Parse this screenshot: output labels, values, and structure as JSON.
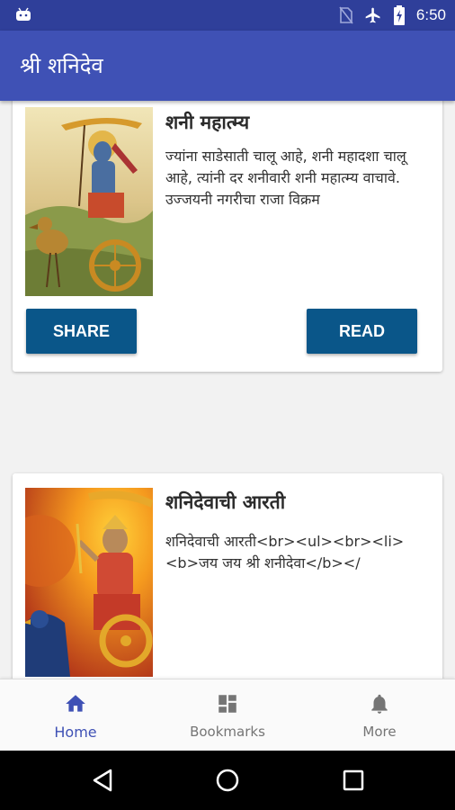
{
  "status_bar": {
    "time": "6:50",
    "icons": [
      "android-icon",
      "no-sim-icon",
      "airplane-mode-icon",
      "battery-charging-icon"
    ]
  },
  "app_bar": {
    "title": "श्री शनिदेव"
  },
  "cards": [
    {
      "title": "शनी महात्म्य",
      "description": "ज्यांना साडेसाती चालू आहे, शनी महादशा चालू आहे, त्यांनी दर शनीवारी शनी महात्म्य वाचावे. उज्जयनी नगरीचा राजा विक्रम",
      "share_label": "SHARE",
      "read_label": "READ"
    },
    {
      "title": "शनिदेवाची आरती",
      "description": "शनिदेवाची आरती<br><ul><br><li><b>जय जय श्री शनीदेवा</b></"
    }
  ],
  "bottom_nav": {
    "items": [
      {
        "label": "Home",
        "icon": "home-icon",
        "active": true
      },
      {
        "label": "Bookmarks",
        "icon": "dashboard-icon",
        "active": false
      },
      {
        "label": "More",
        "icon": "bell-icon",
        "active": false
      }
    ]
  },
  "colors": {
    "status_bar": "#2f3f9a",
    "app_bar": "#3f51b5",
    "button": "#0a5689",
    "active_nav": "#3f51b5",
    "inactive_nav": "#757575"
  }
}
